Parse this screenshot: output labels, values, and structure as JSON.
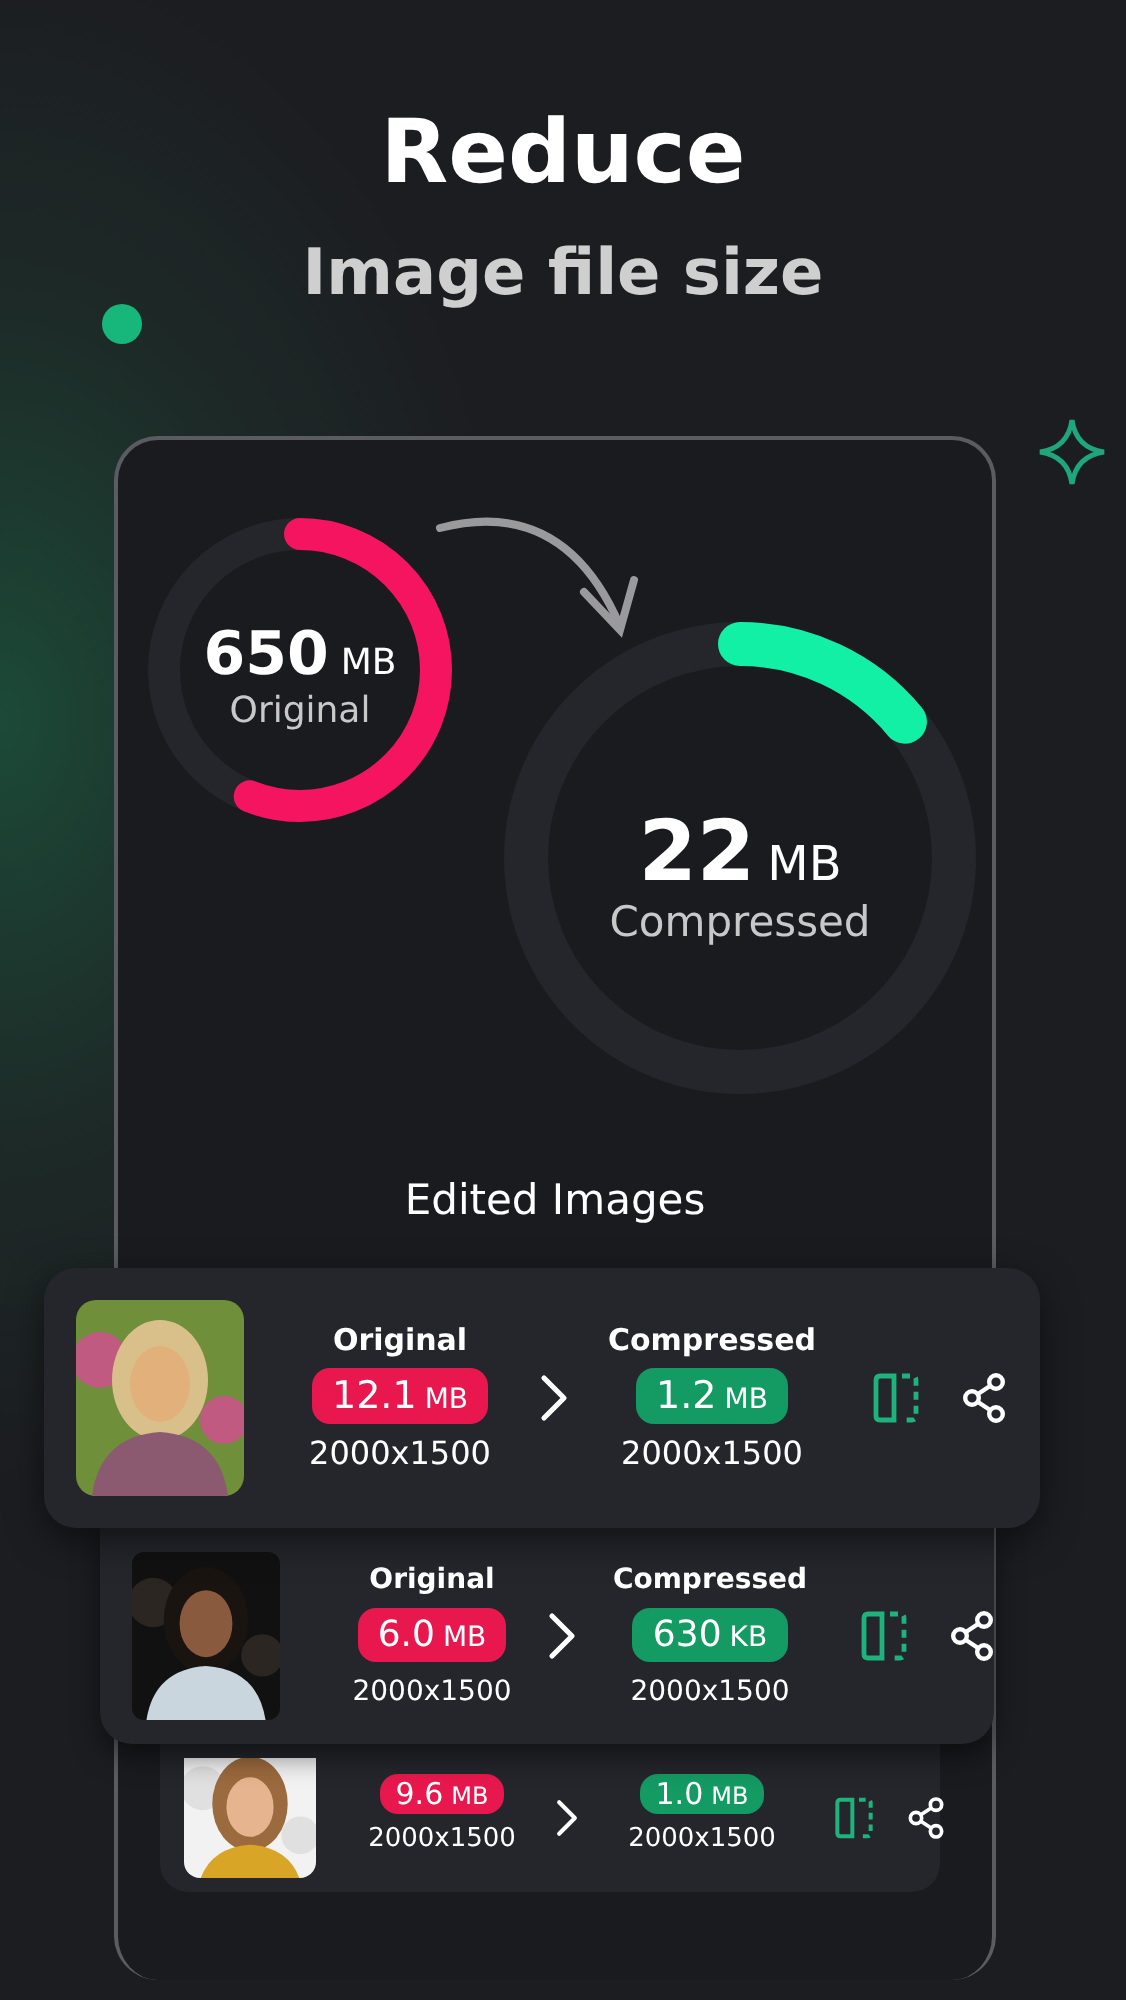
{
  "headline": "Reduce",
  "subheadline": "Image file size",
  "original": {
    "value": "650",
    "unit": "MB",
    "label": "Original",
    "level": 0.56
  },
  "compressed": {
    "value": "22",
    "unit": "MB",
    "label": "Compressed",
    "level": 0.14
  },
  "section_title": "Edited Images",
  "images": [
    {
      "kind": "picture",
      "original_label": "Original",
      "original_size": "12.1",
      "original_unit": "MB",
      "original_dims": "2000x1500",
      "compressed_label": "Compressed",
      "compressed_size": "1.2",
      "compressed_unit": "MB",
      "compressed_dims": "2000x1500"
    },
    {
      "kind": "picture",
      "original_label": "Original",
      "original_size": "6.0",
      "original_unit": "MB",
      "original_dims": "2000x1500",
      "compressed_label": "Compressed",
      "compressed_size": "630",
      "compressed_unit": "KB",
      "compressed_dims": "2000x1500"
    },
    {
      "kind": "picture",
      "original_size": "9.6",
      "original_unit": "MB",
      "original_dims": "2000x1500",
      "compressed_size": "1.0",
      "compressed_unit": "MB",
      "compressed_dims": "2000x1500"
    }
  ]
}
